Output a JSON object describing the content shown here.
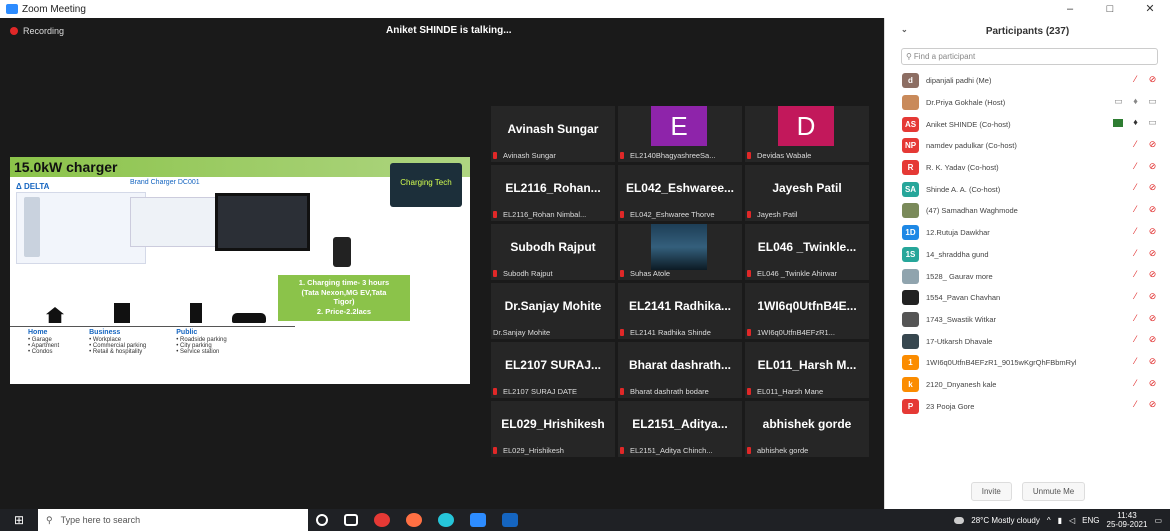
{
  "window": {
    "title": "Zoom Meeting",
    "min": "–",
    "max": "□",
    "close": "✕"
  },
  "meeting": {
    "recording": "Recording",
    "talking": "Aniket SHINDE is talking..."
  },
  "share": {
    "title": "15.0kW charger",
    "logo": "Charging Tech",
    "delta": "Δ DELTA",
    "brand": "Brand Charger DC001",
    "greenbox_lines": [
      "1. Charging time- 3 hours",
      "(Tata Nexon,MG EV,Tata",
      "Tigor)",
      "2. Price-2.2lacs"
    ],
    "cols": [
      {
        "head": "Home",
        "items": [
          "• Garage",
          "• Apartment",
          "• Condos"
        ]
      },
      {
        "head": "Business",
        "items": [
          "• Workplace",
          "• Commercial parking",
          "• Retail & hospitality"
        ]
      },
      {
        "head": "Public",
        "items": [
          "• Roadside parking",
          "• City parking",
          "• Service station"
        ]
      }
    ]
  },
  "tiles": [
    {
      "name": "Avinash Sungar",
      "label": "Avinash Sungar"
    },
    {
      "avatar": "E",
      "color": "#8e24aa",
      "label": "EL2140BhagyashreeSa..."
    },
    {
      "avatar": "D",
      "color": "#c2185b",
      "label": "Devidas Wabale"
    },
    {
      "name": "EL2116_Rohan...",
      "label": "EL2116_Rohan Nimbal..."
    },
    {
      "name": "EL042_Eshwaree...",
      "label": "EL042_Eshwaree Thorve"
    },
    {
      "name": "Jayesh Patil",
      "label": "Jayesh Patil"
    },
    {
      "name": "Subodh Rajput",
      "label": "Subodh Rajput"
    },
    {
      "photo": true,
      "label": "Suhas Atole"
    },
    {
      "name": "EL046 _Twinkle...",
      "label": "EL046 _Twinkle Ahirwar"
    },
    {
      "name": "Dr.Sanjay Mohite",
      "label": "Dr.Sanjay Mohite",
      "nomic": true
    },
    {
      "name": "EL2141 Radhika...",
      "label": "EL2141 Radhika Shinde"
    },
    {
      "name": "1WI6q0UtfnB4E...",
      "label": "1WI6q0UtfnB4EFzR1..."
    },
    {
      "name": "EL2107 SURAJ...",
      "label": "EL2107 SURAJ DATE"
    },
    {
      "name": "Bharat dashrath...",
      "label": "Bharat dashrath bodare"
    },
    {
      "name": "EL011_Harsh M...",
      "label": "EL011_Harsh Mane"
    },
    {
      "name": "EL029_Hrishikesh",
      "label": "EL029_Hrishikesh"
    },
    {
      "name": "EL2151_Aditya...",
      "label": "EL2151_Aditya Chinch..."
    },
    {
      "name": "abhishek gorde",
      "label": "abhishek gorde"
    }
  ],
  "panel": {
    "title": "Participants (237)",
    "search_placeholder": "Find a participant",
    "invite": "Invite",
    "unmute": "Unmute Me",
    "participants": [
      {
        "av": "d",
        "color": "#8d6e63",
        "name": "dipanjali padhi (Me)"
      },
      {
        "av": "",
        "color": "#c98a5a",
        "name": "Dr.Priya Gokhale (Host)",
        "host": true
      },
      {
        "av": "AS",
        "color": "#e53935",
        "name": "Aniket SHINDE (Co-host)",
        "talking": true
      },
      {
        "av": "NP",
        "color": "#e53935",
        "name": "namdev padulkar (Co-host)"
      },
      {
        "av": "R",
        "color": "#e53935",
        "name": "R. K. Yadav (Co-host)"
      },
      {
        "av": "SA",
        "color": "#26a69a",
        "name": "Shinde A. A. (Co-host)"
      },
      {
        "av": "",
        "color": "#7a8a5a",
        "name": "(47) Samadhan Waghmode"
      },
      {
        "av": "1D",
        "color": "#1e88e5",
        "name": "12.Rutuja Dawkhar"
      },
      {
        "av": "1S",
        "color": "#26a69a",
        "name": "14_shraddha gund"
      },
      {
        "av": "",
        "color": "#90a4ae",
        "name": "1528_ Gaurav more"
      },
      {
        "av": "",
        "color": "#222222",
        "name": "1554_Pavan Chavhan"
      },
      {
        "av": "",
        "color": "#555555",
        "name": "1743_Swastik Witkar"
      },
      {
        "av": "",
        "color": "#37474f",
        "name": "17-Utkarsh Dhavale"
      },
      {
        "av": "1",
        "color": "#fb8c00",
        "name": "1WI6q0UtfnB4EFzR1_9015wKgrQhFBbmRyb..."
      },
      {
        "av": "k",
        "color": "#fb8c00",
        "name": "2120_Dnyanesh kale"
      },
      {
        "av": "P",
        "color": "#e53935",
        "name": "23 Pooja Gore"
      }
    ]
  },
  "taskbar": {
    "search": "Type here to search",
    "weather": "28°C Mostly cloudy",
    "lang": "ENG",
    "time": "11:43",
    "date": "25-09-2021"
  }
}
